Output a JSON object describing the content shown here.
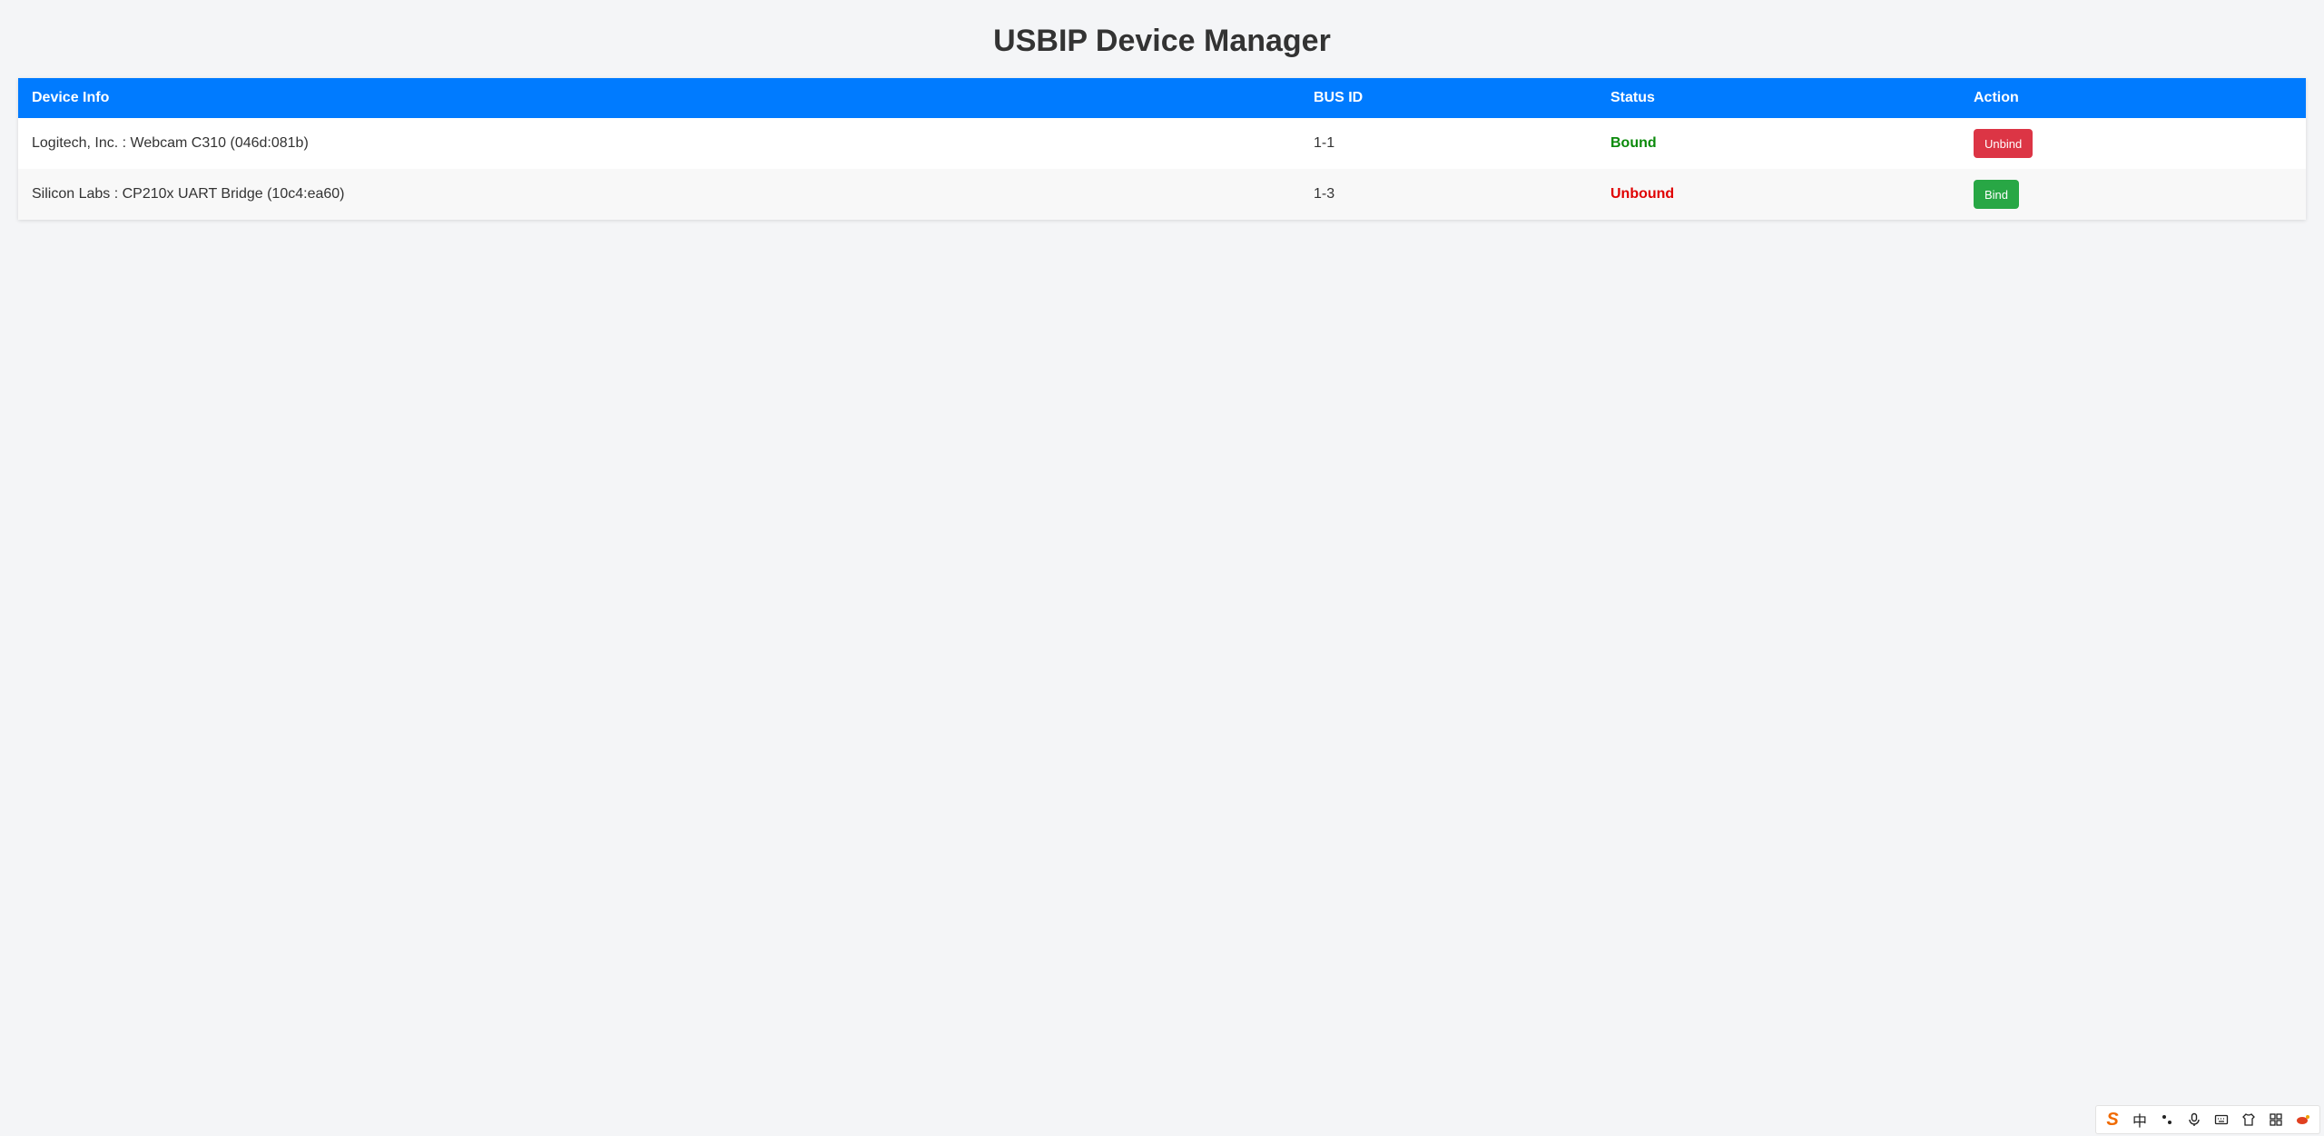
{
  "header": {
    "title": "USBIP Device Manager"
  },
  "table": {
    "columns": [
      "Device Info",
      "BUS ID",
      "Status",
      "Action"
    ],
    "rows": [
      {
        "device_info": "Logitech, Inc. : Webcam C310 (046d:081b)",
        "bus_id": "1-1",
        "status": "Bound",
        "action": "Unbind"
      },
      {
        "device_info": "Silicon Labs : CP210x UART Bridge (10c4:ea60)",
        "bus_id": "1-3",
        "status": "Unbound",
        "action": "Bind"
      }
    ]
  },
  "colors": {
    "header_bg": "#007bff",
    "bound": "#0a8a0a",
    "unbound": "#e00000",
    "unbind_button": "#dc3545",
    "bind_button": "#28a745"
  },
  "ime_toolbar": {
    "logo": "S",
    "mode": "中",
    "icons": [
      "punctuation-icon",
      "microphone-icon",
      "keyboard-icon",
      "skin-icon",
      "toolbox-icon",
      "emoji-icon"
    ]
  }
}
